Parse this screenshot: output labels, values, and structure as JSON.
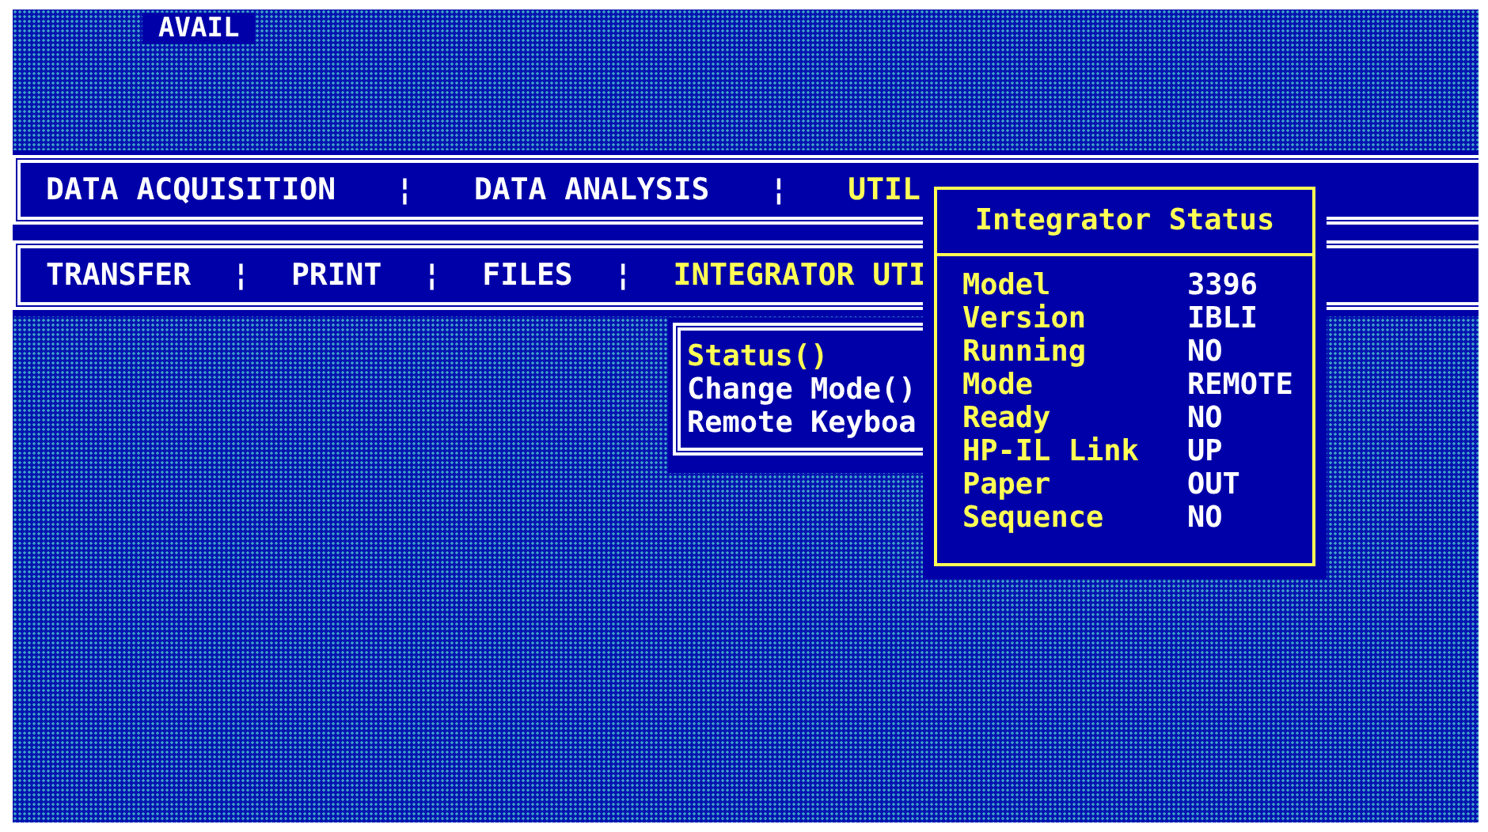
{
  "status_label": "AVAIL",
  "main_menu": [
    {
      "kind": "item",
      "text": "DATA ACQUISITION",
      "selected": false
    },
    {
      "kind": "separator",
      "text": "¦"
    },
    {
      "kind": "item",
      "text": "DATA ANALYSIS",
      "selected": false
    },
    {
      "kind": "separator",
      "text": "¦"
    },
    {
      "kind": "item",
      "text": "UTIL",
      "selected": true
    }
  ],
  "sub_menu": [
    {
      "kind": "item",
      "text": "TRANSFER",
      "selected": false
    },
    {
      "kind": "separator",
      "text": "¦"
    },
    {
      "kind": "item",
      "text": "PRINT",
      "selected": false
    },
    {
      "kind": "separator",
      "text": "¦"
    },
    {
      "kind": "item",
      "text": "FILES",
      "selected": false
    },
    {
      "kind": "separator",
      "text": "¦"
    },
    {
      "kind": "item",
      "text": "INTEGRATOR UTI",
      "selected": true
    }
  ],
  "dropdown": [
    {
      "text": "Status()",
      "selected": true
    },
    {
      "text": "Change Mode()",
      "selected": false
    },
    {
      "text": "Remote Keyboa",
      "selected": false
    }
  ],
  "status_dialog": {
    "title": "Integrator Status",
    "rows": [
      {
        "label": "Model",
        "value": "3396"
      },
      {
        "label": "Version",
        "value": "IBLI"
      },
      {
        "label": "Running",
        "value": "NO"
      },
      {
        "label": "Mode",
        "value": "REMOTE"
      },
      {
        "label": "Ready",
        "value": "NO"
      },
      {
        "label": "HP-IL Link",
        "value": "UP"
      },
      {
        "label": "Paper",
        "value": "OUT"
      },
      {
        "label": "Sequence",
        "value": "NO"
      }
    ]
  }
}
